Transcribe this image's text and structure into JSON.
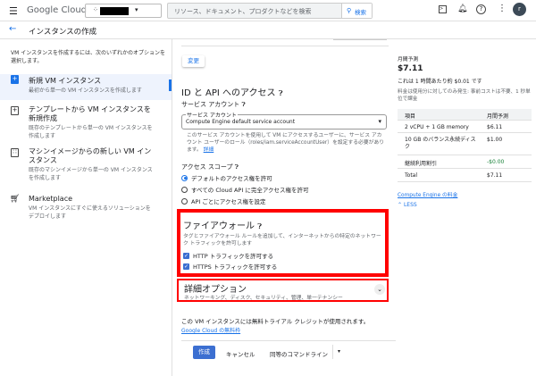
{
  "header": {
    "brand": "Google Cloud",
    "search_placeholder": "リソース、ドキュメント、プロダクトなどを検索",
    "search_button": "検索",
    "avatar": "r"
  },
  "page": {
    "title": "インスタンスの作成"
  },
  "sidebar": {
    "intro": "VM インスタンスを作成するには、次のいずれかのオプションを選択します。",
    "items": [
      {
        "title": "新規 VM インスタンス",
        "desc": "最初から単一の VM インスタンスを作成します",
        "selected": true
      },
      {
        "title": "テンプレートから VM インスタンスを新規作成",
        "desc": "既存のテンプレートから単一の VM インスタンスを作成します"
      },
      {
        "title": "マシンイメージからの新しい VM インスタンス",
        "desc": "既存のマシンイメージから単一の VM インスタンスを作成します"
      },
      {
        "title": "Marketplace",
        "desc": "VM インスタンスにすぐに使えるソリューションをデプロイします"
      }
    ]
  },
  "main": {
    "change_button": "変更",
    "id_api": {
      "heading": "ID と API へのアクセス",
      "sa_label": "サービス アカウント",
      "sa_field_label": "サービス アカウント",
      "sa_value": "Compute Engine default service account",
      "sa_help": "このサービス アカウントを使用して VM にアクセスするユーザーに、サービス アカウント ユーザーのロール（roles/iam.serviceAccountUser）を設定する必要があります。",
      "sa_help_link": "詳細",
      "scope_label": "アクセス スコープ",
      "scopes": [
        "デフォルトのアクセス権を許可",
        "すべての Cloud API に完全アクセス権を許可",
        "API ごとにアクセス権を設定"
      ],
      "selected_scope": 0
    },
    "firewall": {
      "heading": "ファイアウォール",
      "desc": "タグとファイアウォール ルールを追加して、インターネットからの特定のネットワーク トラフィックを許可します",
      "http": "HTTP トラフィックを許可する",
      "https": "HTTPS トラフィックを許可する",
      "http_checked": true,
      "https_checked": true
    },
    "advanced": {
      "heading": "詳細オプション",
      "desc": "ネットワーキング、ディスク、セキュリティ、管理、単一テナンシー"
    },
    "trial_note": "この VM インスタンスには無料トライアル クレジットが使用されます。",
    "trial_link": "Google Cloud の無料枠",
    "actions": {
      "create": "作成",
      "cancel": "キャンセル",
      "cmdline": "同等のコマンドライン"
    }
  },
  "pricing": {
    "label": "月間予測",
    "total": "$7.11",
    "hourly": "これは 1 時間あたり約 $0.01 です",
    "note": "料金は使用分に対してのみ発生: 事前コストは不要、1 秒単位で課金",
    "header": [
      "項目",
      "月間予測"
    ],
    "rows": [
      [
        "2 vCPU + 1 GB memory",
        "$6.11"
      ],
      [
        "10 GB のバランス永続ディスク",
        "$1.00"
      ],
      [
        "継続利用割引",
        "-$0.00"
      ],
      [
        "Total",
        "$7.11"
      ]
    ],
    "link": "Compute Engine の料金",
    "less": "LESS"
  },
  "colors": {
    "accent": "#1a73e8",
    "highlight": "#ff0000",
    "discount": "#188038"
  }
}
